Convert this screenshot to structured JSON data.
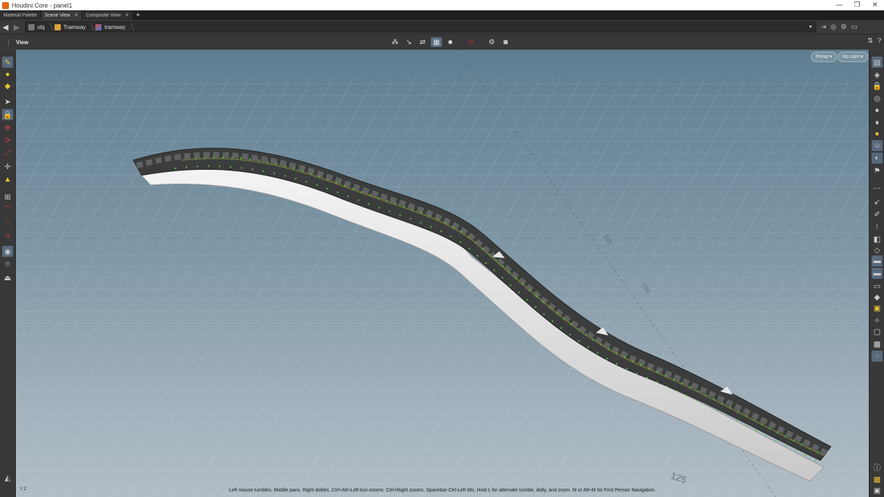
{
  "window": {
    "title": "Houdini Core - panel1",
    "controls": [
      "minimize",
      "maximize",
      "close"
    ]
  },
  "tabs": [
    {
      "label": "Material Palette",
      "active": false
    },
    {
      "label": "Scene View",
      "active": true
    },
    {
      "label": "Composite View",
      "active": false
    }
  ],
  "pathbar": {
    "crumbs": [
      {
        "label": "obj",
        "icon": "network-icon"
      },
      {
        "label": "Tramway",
        "icon": "geo-object-icon"
      },
      {
        "label": "tramway",
        "icon": "sop-node-icon"
      }
    ]
  },
  "viewbar": {
    "label": "View"
  },
  "viewport": {
    "projection_button": "Persp ▾",
    "camera_button": "No cam ▾",
    "status_message": "Left mouse tumbles. Middle pans. Right dollies. Ctrl+Alt+Left box-zooms. Ctrl+Right zooms. Spacebar-Ctrl-Left tilts. Hold L for alternate tumble, dolly, and zoom.     M or Alt+M for First Person Navigation.",
    "grid_labels": [
      "125",
      "125",
      "125"
    ],
    "axis_label": "Y Z"
  },
  "colors": {
    "accent_blue": "#5a6f86",
    "road_dark": "#3b3d3d",
    "foliage_green": "#4fae3a",
    "viewport_top": "#5f7e91",
    "viewport_bottom": "#b1bdc5"
  }
}
